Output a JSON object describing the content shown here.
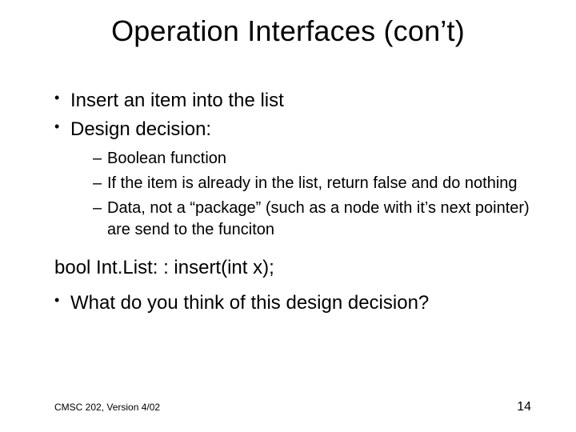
{
  "title": "Operation Interfaces (con’t)",
  "bullets_top": [
    "Insert an item into the list",
    "Design decision:"
  ],
  "sub_bullets": [
    "Boolean function",
    "If the item is already in the list, return false and do nothing",
    "Data, not a “package” (such as a node with it’s next pointer) are send to the funciton"
  ],
  "code_line": "bool Int.List: : insert(int x);",
  "bullets_bottom": [
    "What do you think of this design decision?"
  ],
  "footer": {
    "course": "CMSC 202, Version 4/02",
    "page": "14"
  }
}
